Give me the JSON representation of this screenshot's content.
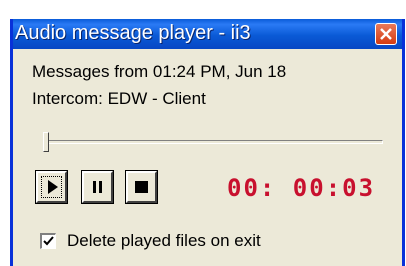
{
  "window": {
    "title": "Audio message player - ii3",
    "close_icon": "close-icon",
    "colors": {
      "titlebar": "#0a5ad6",
      "close_button": "#d43b11",
      "face": "#ece9d8",
      "timer": "#c8102e"
    }
  },
  "info": {
    "messages_from": "Messages from  01:24 PM, Jun 18",
    "intercom": "Intercom:  EDW - Client"
  },
  "playback": {
    "position_fraction": 0.0,
    "timer": "00: 00:03",
    "buttons": [
      {
        "name": "play",
        "icon": "play-icon",
        "focused": true
      },
      {
        "name": "pause",
        "icon": "pause-icon"
      },
      {
        "name": "stop",
        "icon": "stop-icon"
      }
    ]
  },
  "options": {
    "delete_played_label": "Delete played files on exit",
    "delete_played_checked": true
  }
}
